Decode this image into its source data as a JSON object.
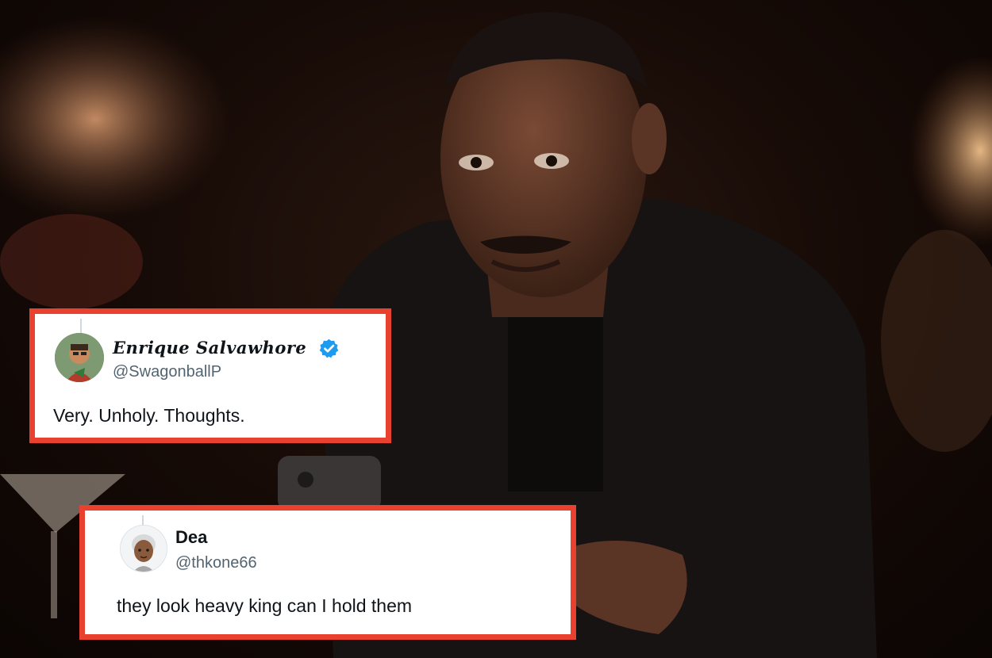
{
  "tweets": [
    {
      "display_name": "Enrique Salvawhore",
      "handle": "@SwagonballP",
      "verified": true,
      "text": "Very. Unholy. Thoughts.",
      "avatar_icon": "cartoon-avatar-icon"
    },
    {
      "display_name": "Dea",
      "handle": "@thkone66",
      "verified": false,
      "text": "they look heavy king can I hold them",
      "avatar_icon": "memoji-avatar-icon"
    }
  ],
  "colors": {
    "card_border": "#e8412f",
    "card_background": "#ffffff",
    "handle_text": "#536471",
    "verified_badge": "#1d9bf0"
  }
}
